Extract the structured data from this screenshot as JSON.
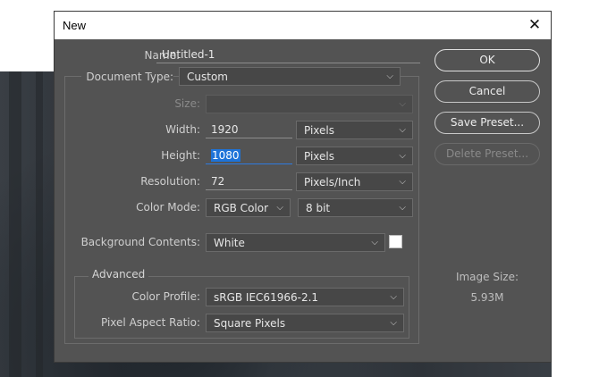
{
  "dialog": {
    "title": "New",
    "name_label": "Name:",
    "name_value": "Untitled-1",
    "document_type_label": "Document Type:",
    "document_type_value": "Custom",
    "size_label": "Size:",
    "size_value": "",
    "width_label": "Width:",
    "width_value": "1920",
    "width_unit": "Pixels",
    "height_label": "Height:",
    "height_value": "1080",
    "height_unit": "Pixels",
    "resolution_label": "Resolution:",
    "resolution_value": "72",
    "resolution_unit": "Pixels/Inch",
    "color_mode_label": "Color Mode:",
    "color_mode_value": "RGB Color",
    "bit_depth_value": "8 bit",
    "background_label": "Background Contents:",
    "background_value": "White",
    "background_swatch_color": "#ffffff",
    "advanced_label": "Advanced",
    "color_profile_label": "Color Profile:",
    "color_profile_value": "sRGB IEC61966-2.1",
    "pixel_aspect_label": "Pixel Aspect Ratio:",
    "pixel_aspect_value": "Square Pixels"
  },
  "buttons": {
    "ok": "OK",
    "cancel": "Cancel",
    "save_preset": "Save Preset...",
    "delete_preset": "Delete Preset..."
  },
  "image_size": {
    "label": "Image Size:",
    "value": "5.93M"
  },
  "icons": {
    "close": "close-icon",
    "dropdown": "chevron-down-icon"
  }
}
